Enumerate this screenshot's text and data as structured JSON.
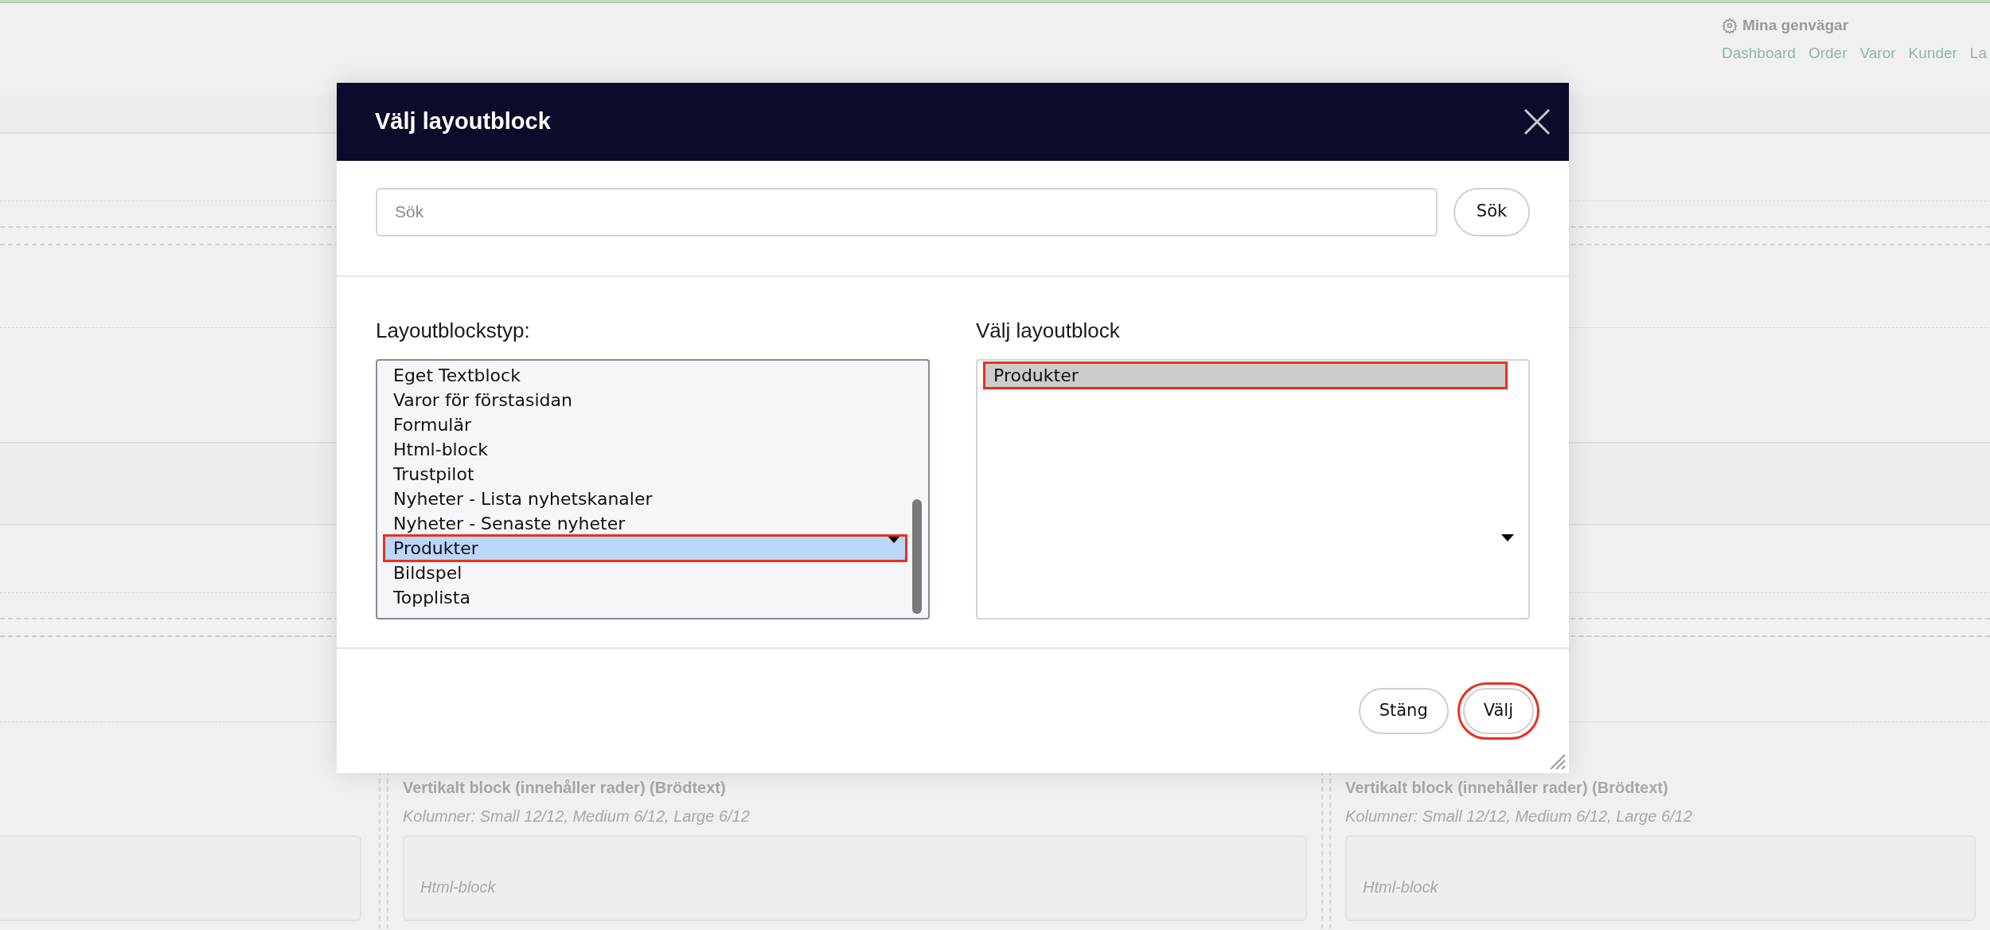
{
  "top_bar": {
    "shortcuts_title": "Mina genvägar",
    "shortcuts": [
      "Dashboard",
      "Order",
      "Varor",
      "Kunder",
      "La"
    ]
  },
  "background_columns": [
    {
      "title": "Vertikalt block (innehåller rader) (Brödtext)",
      "info": "Kolumner: Small 12/12, Medium 6/12, Large 6/12",
      "card_label": "Html-block"
    },
    {
      "title": "Vertikalt block (innehåller rader) (Brödtext)",
      "info": "Kolumner: Small 12/12, Medium 6/12, Large 6/12",
      "card_label": "Html-block"
    }
  ],
  "dialog": {
    "title": "Välj layoutblock",
    "search": {
      "placeholder": "Sök",
      "button": "Sök"
    },
    "type_list": {
      "label": "Layoutblockstyp:",
      "focused": true,
      "items": [
        {
          "label": "Eget Textblock",
          "selected": false,
          "marked": false
        },
        {
          "label": "Varor för förstasidan",
          "selected": false,
          "marked": false
        },
        {
          "label": "Formulär",
          "selected": false,
          "marked": false
        },
        {
          "label": "Html-block",
          "selected": false,
          "marked": false
        },
        {
          "label": "Trustpilot",
          "selected": false,
          "marked": false
        },
        {
          "label": "Nyheter - Lista nyhetskanaler",
          "selected": false,
          "marked": false
        },
        {
          "label": "Nyheter - Senaste nyheter",
          "selected": false,
          "marked": false
        },
        {
          "label": "Produkter",
          "selected": true,
          "marked": true
        },
        {
          "label": "Bildspel",
          "selected": false,
          "marked": false
        },
        {
          "label": "Topplista",
          "selected": false,
          "marked": false
        }
      ]
    },
    "block_list": {
      "label": "Välj layoutblock",
      "focused": false,
      "items": [
        {
          "label": "Produkter",
          "selected": true,
          "marked": true
        }
      ]
    },
    "buttons": [
      {
        "label": "Stäng",
        "marked": false
      },
      {
        "label": "Välj",
        "marked": true
      }
    ]
  }
}
